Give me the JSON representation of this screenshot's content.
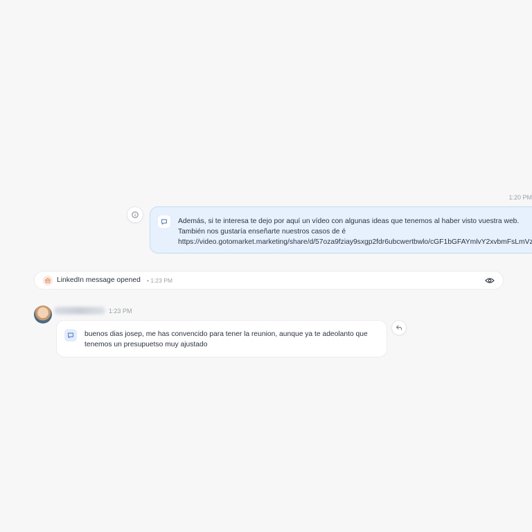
{
  "outgoing_message": {
    "time": "1:20 PM",
    "icon": "message-icon",
    "lines": [
      "Además, si te interesa te dejo por aquí un vídeo con algunas ideas que tenemos al haber visto vuestra web.",
      "También nos gustaría enseñarte nuestros casos de é",
      "https://video.gotomarket.marketing/share/d/57oza9fziay9sxgp2fdr6ubcwertbwlo/cGF1bGFAYmlvY2xvbmFsLmVz"
    ]
  },
  "activity": {
    "label": "LinkedIn message opened",
    "meta": "• 1:23 PM",
    "icon": "linkedin-open-icon",
    "action_icon": "eye-icon"
  },
  "incoming_message": {
    "time": "1:23 PM",
    "icon": "message-icon",
    "text": "buenos dias josep, me has convencido para tener la reunion, aunque ya te adeolanto que tenemos un presupuetso muy ajustado"
  },
  "colors": {
    "outgoing_bubble": "#e7f1fd",
    "outgoing_border": "#c5dbf5",
    "background": "#f7f7f7",
    "accent": "#3b6fd4"
  }
}
